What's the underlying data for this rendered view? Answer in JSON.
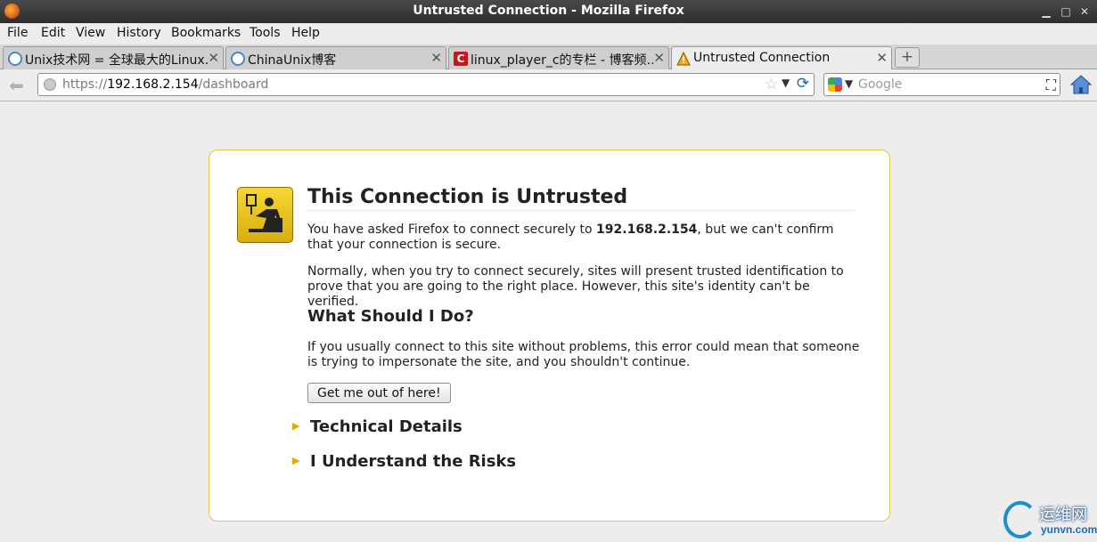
{
  "window": {
    "title": "Untrusted Connection - Mozilla Firefox"
  },
  "menu": [
    "File",
    "Edit",
    "View",
    "History",
    "Bookmarks",
    "Tools",
    "Help"
  ],
  "tabs": [
    {
      "label": "Unix技术网 = 全球最大的Linux…",
      "favicon": "unix-favicon"
    },
    {
      "label": "ChinaUnix博客",
      "favicon": "unix-favicon"
    },
    {
      "label": "linux_player_c的专栏 - 博客频…",
      "favicon": "csdn-favicon"
    },
    {
      "label": "Untrusted Connection",
      "favicon": "warning-icon",
      "active": true
    }
  ],
  "url": {
    "scheme": "https://",
    "host": "192.168.2.154",
    "path": "/dashboard"
  },
  "search": {
    "placeholder": "Google"
  },
  "error": {
    "title": "This Connection is Untrusted",
    "p1_before": "You have asked Firefox to connect securely to ",
    "p1_host": "192.168.2.154",
    "p1_after": ", but we can't confirm that your connection is secure.",
    "p2": "Normally, when you try to connect securely, sites will present trusted identification to prove that you are going to the right place. However, this site's identity can't be verified.",
    "h_what": "What Should I Do?",
    "p3": "If you usually connect to this site without problems, this error could mean that someone is trying to impersonate the site, and you shouldn't continue.",
    "get_out_button": "Get me out of here!",
    "technical_details": "Technical Details",
    "understand_risks": "I Understand the Risks"
  },
  "watermark": {
    "cn": "运维网",
    "en": "yunvn.com"
  },
  "colors": {
    "box_border": "#e6c64a",
    "icon_yellow": "#f6d733",
    "expander_arrow": "#e3a800"
  }
}
